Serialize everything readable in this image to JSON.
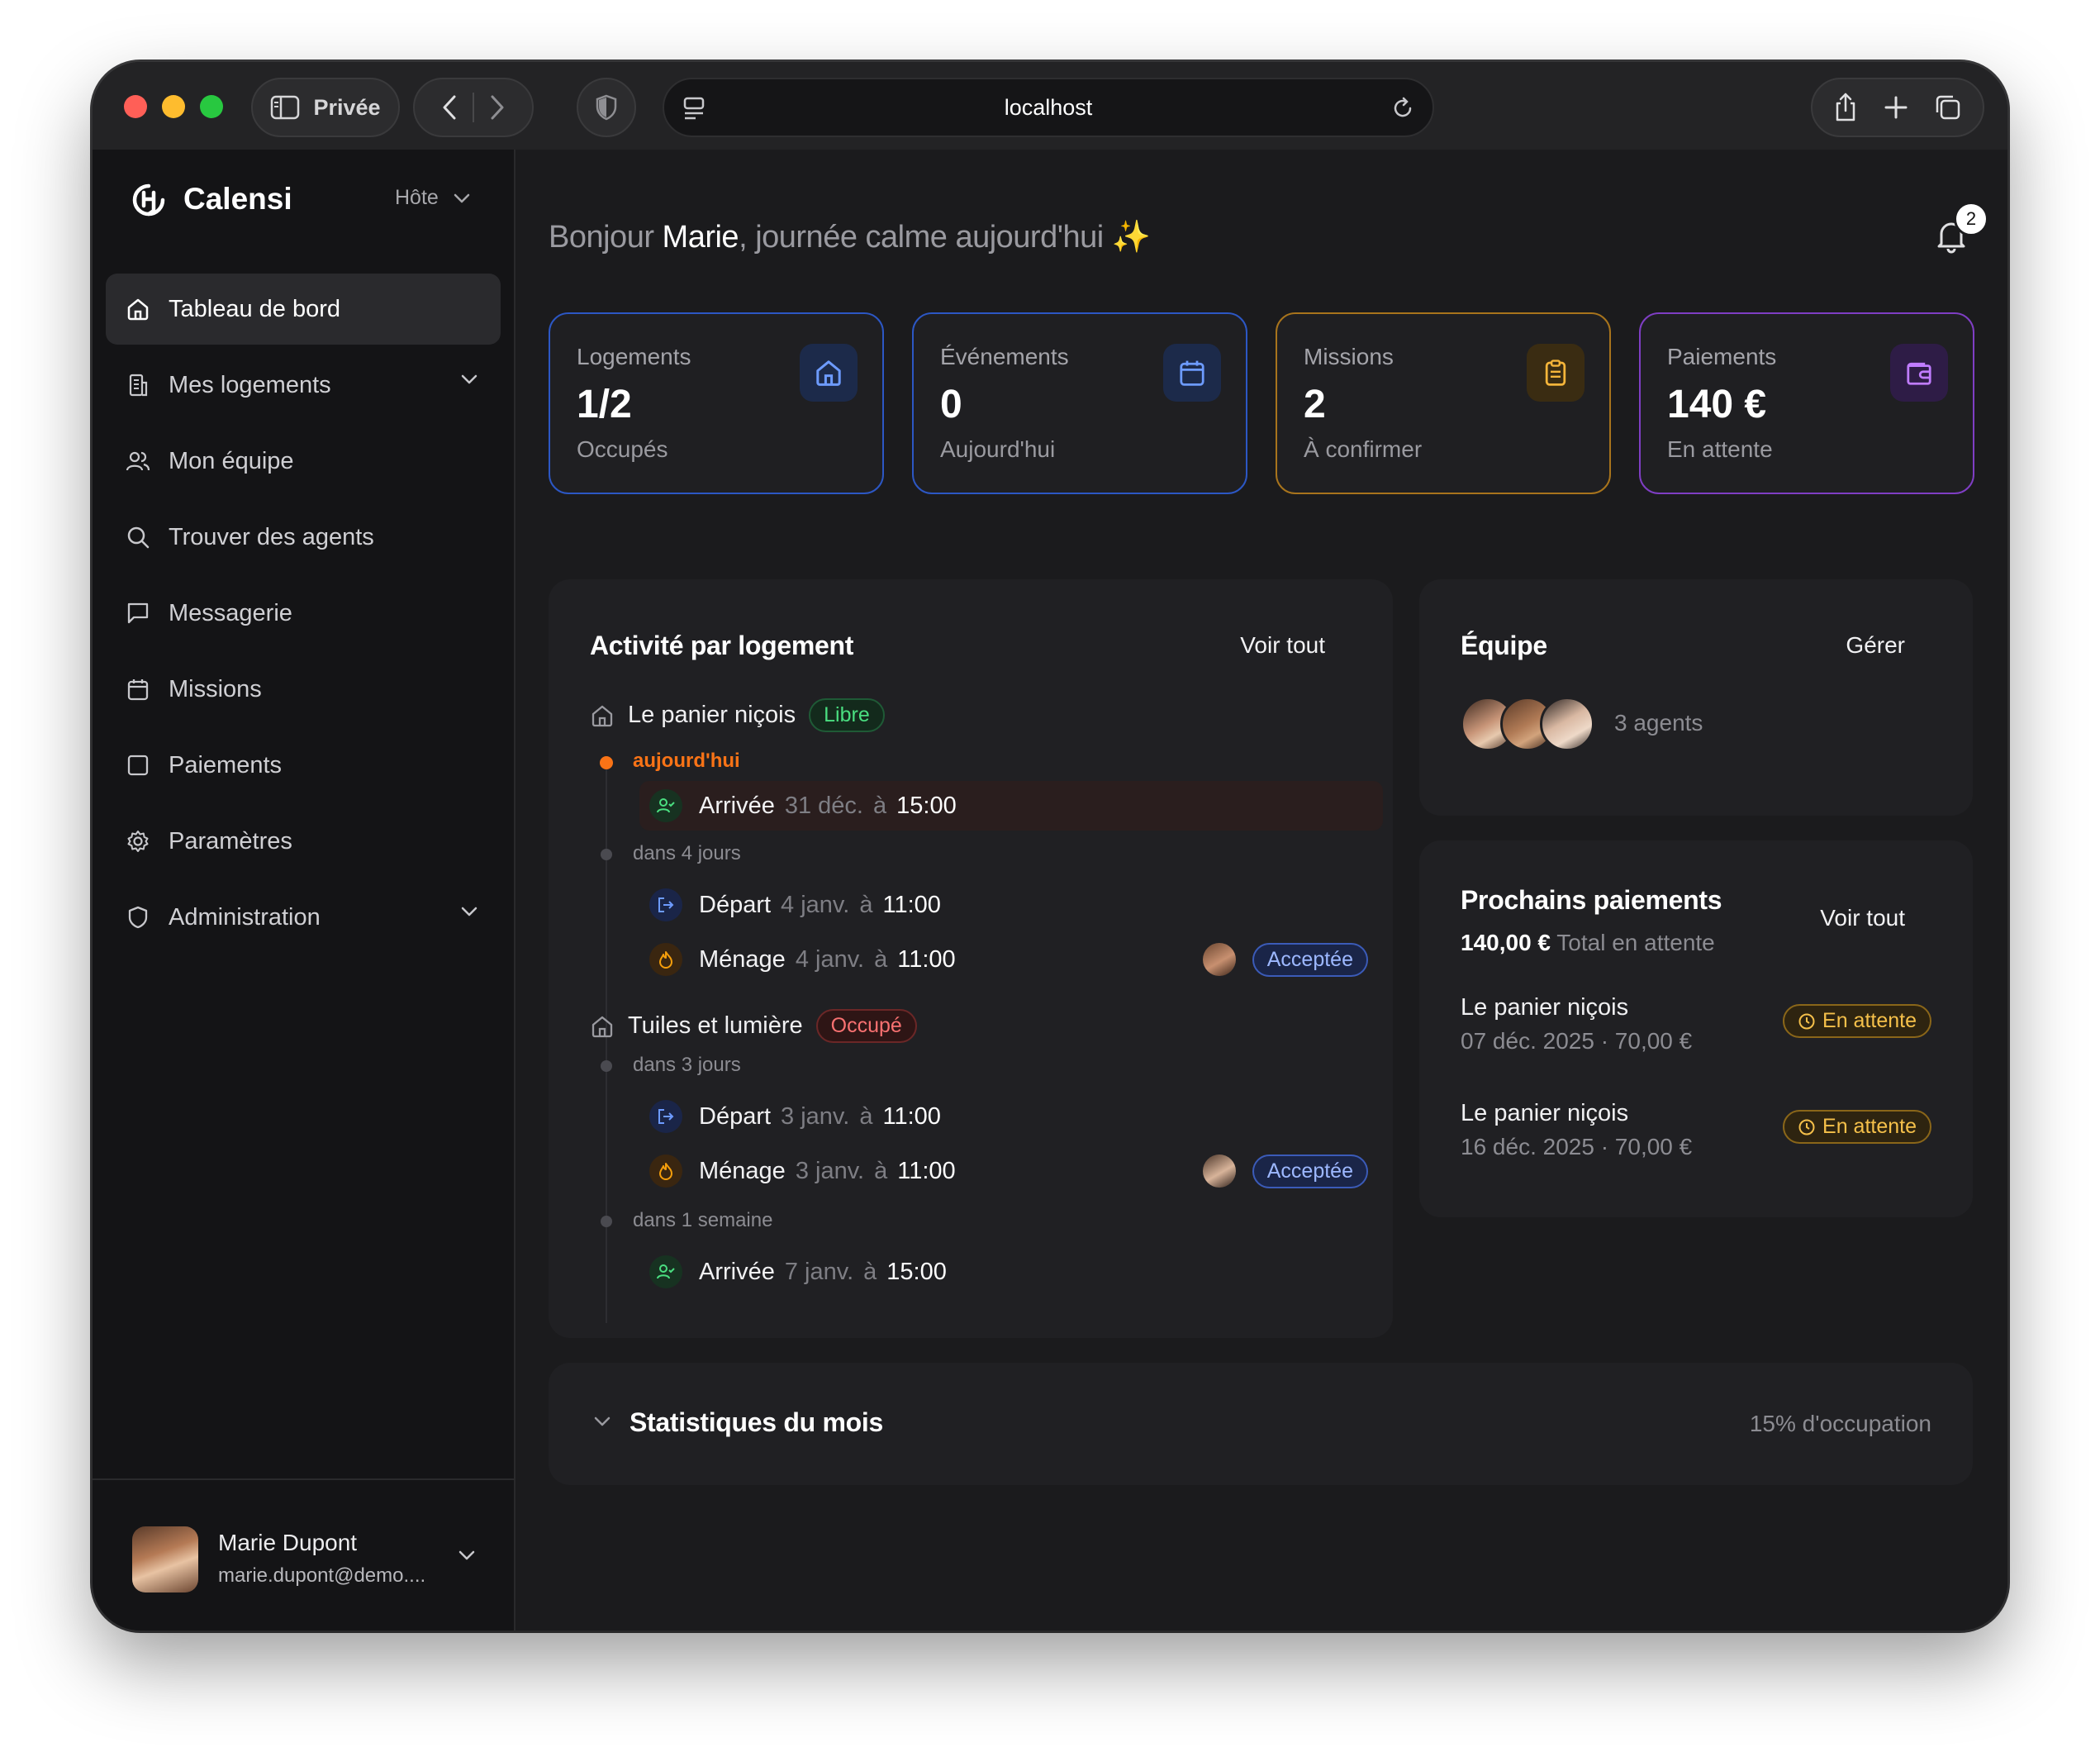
{
  "browser": {
    "private_label": "Privée",
    "url": "localhost"
  },
  "sidebar": {
    "brand": "Calensi",
    "role": "Hôte",
    "items": [
      {
        "label": "Tableau de bord",
        "icon": "home-icon",
        "active": true
      },
      {
        "label": "Mes logements",
        "icon": "building-icon",
        "has_chevron": true
      },
      {
        "label": "Mon équipe",
        "icon": "users-icon"
      },
      {
        "label": "Trouver des agents",
        "icon": "search-icon"
      },
      {
        "label": "Messagerie",
        "icon": "message-icon"
      },
      {
        "label": "Missions",
        "icon": "calendar-icon"
      },
      {
        "label": "Paiements",
        "icon": "square-icon"
      },
      {
        "label": "Paramètres",
        "icon": "gear-icon"
      },
      {
        "label": "Administration",
        "icon": "shield-icon",
        "has_chevron": true
      }
    ],
    "user": {
      "name": "Marie Dupont",
      "email": "marie.dupont@demo...."
    }
  },
  "header": {
    "greeting_prefix": "Bonjour ",
    "greeting_name": "Marie",
    "greeting_suffix": ", journée calme aujourd'hui ✨",
    "notifications_count": "2"
  },
  "stats": [
    {
      "label": "Logements",
      "value": "1/2",
      "sub": "Occupés",
      "color": "#3b6fe0",
      "icon": "home-icon"
    },
    {
      "label": "Événements",
      "value": "0",
      "sub": "Aujourd'hui",
      "color": "#3b6fe0",
      "icon": "calendar-icon"
    },
    {
      "label": "Missions",
      "value": "2",
      "sub": "À confirmer",
      "color": "#c68a1f",
      "icon": "clipboard-icon"
    },
    {
      "label": "Paiements",
      "value": "140 €",
      "sub": "En attente",
      "color": "#9b4de0",
      "icon": "wallet-icon"
    }
  ],
  "activity": {
    "title": "Activité par logement",
    "link": "Voir tout",
    "properties": [
      {
        "name": "Le panier niçois",
        "status": "Libre"
      },
      {
        "name": "Tuiles et lumière",
        "status": "Occupé"
      }
    ],
    "groups": {
      "g1": "aujourd'hui",
      "g2": "dans 4 jours",
      "g3": "dans 3 jours",
      "g4": "dans 1 semaine"
    },
    "events": {
      "e1": {
        "type": "Arrivée",
        "date": "31 déc.",
        "at": "à",
        "time": "15:00"
      },
      "e2": {
        "type": "Départ",
        "date": "4 janv.",
        "at": "à",
        "time": "11:00"
      },
      "e3": {
        "type": "Ménage",
        "date": "4 janv.",
        "at": "à",
        "time": "11:00",
        "badge": "Acceptée"
      },
      "e4": {
        "type": "Départ",
        "date": "3 janv.",
        "at": "à",
        "time": "11:00"
      },
      "e5": {
        "type": "Ménage",
        "date": "3 janv.",
        "at": "à",
        "time": "11:00",
        "badge": "Acceptée"
      },
      "e6": {
        "type": "Arrivée",
        "date": "7 janv.",
        "at": "à",
        "time": "15:00"
      }
    }
  },
  "team": {
    "title": "Équipe",
    "link": "Gérer",
    "count_label": "3 agents"
  },
  "payments": {
    "title": "Prochains paiements",
    "link": "Voir tout",
    "total_value": "140,00 €",
    "total_label": "Total en attente",
    "rows": [
      {
        "name": "Le panier niçois",
        "meta": "07 déc. 2025 · 70,00 €",
        "status": "En attente"
      },
      {
        "name": "Le panier niçois",
        "meta": "16 déc. 2025 · 70,00 €",
        "status": "En attente"
      }
    ]
  },
  "monthly": {
    "title": "Statistiques du mois",
    "occupancy": "15% d'occupation"
  }
}
